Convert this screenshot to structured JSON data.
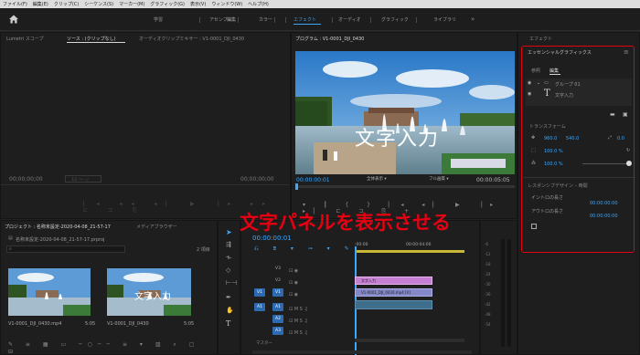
{
  "menu": [
    "ファイル(F)",
    "編集(E)",
    "クリップ(C)",
    "シーケンス(S)",
    "マーカー(M)",
    "グラフィック(G)",
    "表示(V)",
    "ウィンドウ(W)",
    "ヘルプ(H)"
  ],
  "workspaces": [
    {
      "label": "学習",
      "active": false
    },
    {
      "label": "アセンブリ",
      "active": false
    },
    {
      "label": "編集",
      "active": false
    },
    {
      "label": "カラー",
      "active": false
    },
    {
      "label": "エフェクト",
      "active": true
    },
    {
      "label": "オーディオ",
      "active": false
    },
    {
      "label": "グラフィック",
      "active": false
    },
    {
      "label": "ライブラリ",
      "active": false
    }
  ],
  "source_panel": {
    "tabs": [
      "Lumetri スコープ",
      "ソース : (クリップなし)",
      "オーディオクリップミキサー : V1-0001_DJI_0430"
    ],
    "timecode_left": "00;00;00;00",
    "timecode_right": "00;00;00;00",
    "page": "1/2 ページ"
  },
  "program_panel": {
    "title": "プログラム : V1-0001_DJI_0430",
    "timecode": "00:00:00:01",
    "fit": "全体表示",
    "quality": "フル画質",
    "duration": "00:00:05:05",
    "overlay_text": "文字入力"
  },
  "effects_panel": {
    "title": "エフェクト",
    "eg_title": "エッセンシャルグラフィックス",
    "eg_tabs": [
      "参照",
      "編集"
    ],
    "layers": [
      {
        "name": "グループ 01",
        "icon": "folder-icon"
      },
      {
        "name": "文字入力",
        "icon": "text-icon"
      }
    ],
    "transform_label": "トランスフォーム",
    "pos_x": "960.0",
    "pos_y": "540.0",
    "rotation": "0.0",
    "scale": "100.0 %",
    "opacity": "100.0 %",
    "responsive_label": "レスポンシブデザイン – 時間",
    "intro_label": "イントロの長さ",
    "outro_label": "アウトロの長さ",
    "intro_value": "00:00:00:00",
    "outro_value": "00:00:00:00"
  },
  "project_panel": {
    "title": "プロジェクト : 名称未設定-2020-04-08_21-57-17",
    "tab2": "メディアブラウザー",
    "file": "名称未設定-2020-04-08_21-57-17.prproj",
    "count": "2 項目",
    "items": [
      {
        "name": "V1-0001_DJI_0430.mp4",
        "dur": "5:05"
      },
      {
        "name": "V1-0001_DJI_0430",
        "dur": "5:05"
      }
    ]
  },
  "timeline": {
    "timecode": "00:00:00:01",
    "ruler": [
      ":00:00",
      "00:00:04:00"
    ],
    "video_tracks": [
      "V3",
      "V2",
      "V1"
    ],
    "audio_tracks": [
      "A1",
      "A2",
      "A3"
    ],
    "master": "マスター",
    "clips": {
      "title": "文字入力",
      "video": "V1-0001_DJI_0430.mp4 [V]"
    }
  },
  "annotation": "文字パネルを表示させる",
  "colors": {
    "accent": "#3aa8ff",
    "annotation_red": "#e60012",
    "pink_clip": "#c77fd3",
    "blue_clip": "#8488c9"
  }
}
